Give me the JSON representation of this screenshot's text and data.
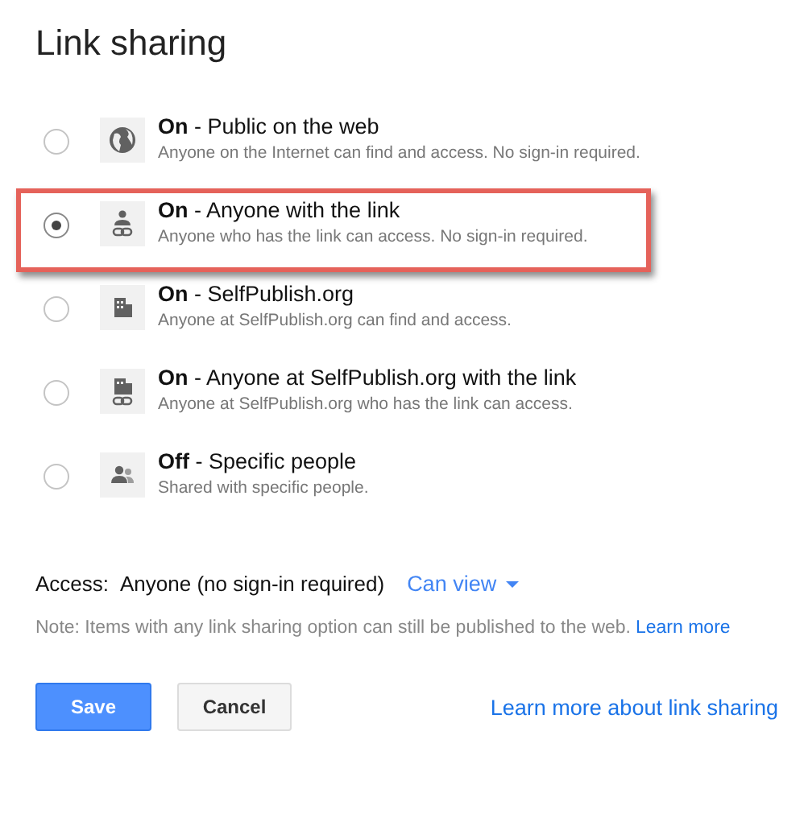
{
  "title": "Link sharing",
  "options": [
    {
      "kind": "globe",
      "label": "**On** - Public on the web",
      "description": "Anyone on the Internet can find and access. No sign-in required.",
      "selected": false
    },
    {
      "kind": "person-link",
      "label": "**On** - Anyone with the link",
      "description": "Anyone who has the link can access. No sign-in required.",
      "selected": true
    },
    {
      "kind": "building",
      "label": "**On** - SelfPublish.org",
      "description": "Anyone at SelfPublish.org can find and access.",
      "selected": false
    },
    {
      "kind": "building-link",
      "label": "**On** - Anyone at SelfPublish.org with the link",
      "description": "Anyone at SelfPublish.org who has the link can access.",
      "selected": false
    },
    {
      "kind": "people",
      "label": "**Off** - Specific people",
      "description": "Shared with specific people.",
      "selected": false
    }
  ],
  "access": {
    "label": "Access:",
    "value": "Anyone (no sign-in required)",
    "permission": "Can view"
  },
  "note": {
    "text": "Note: Items with any link sharing option can still be published to the web.",
    "link": "Learn more"
  },
  "buttons": [
    {
      "kind": "primary",
      "label": "Save"
    },
    {
      "kind": "secondary",
      "label": "Cancel"
    }
  ],
  "help_link": "Learn more about link sharing"
}
